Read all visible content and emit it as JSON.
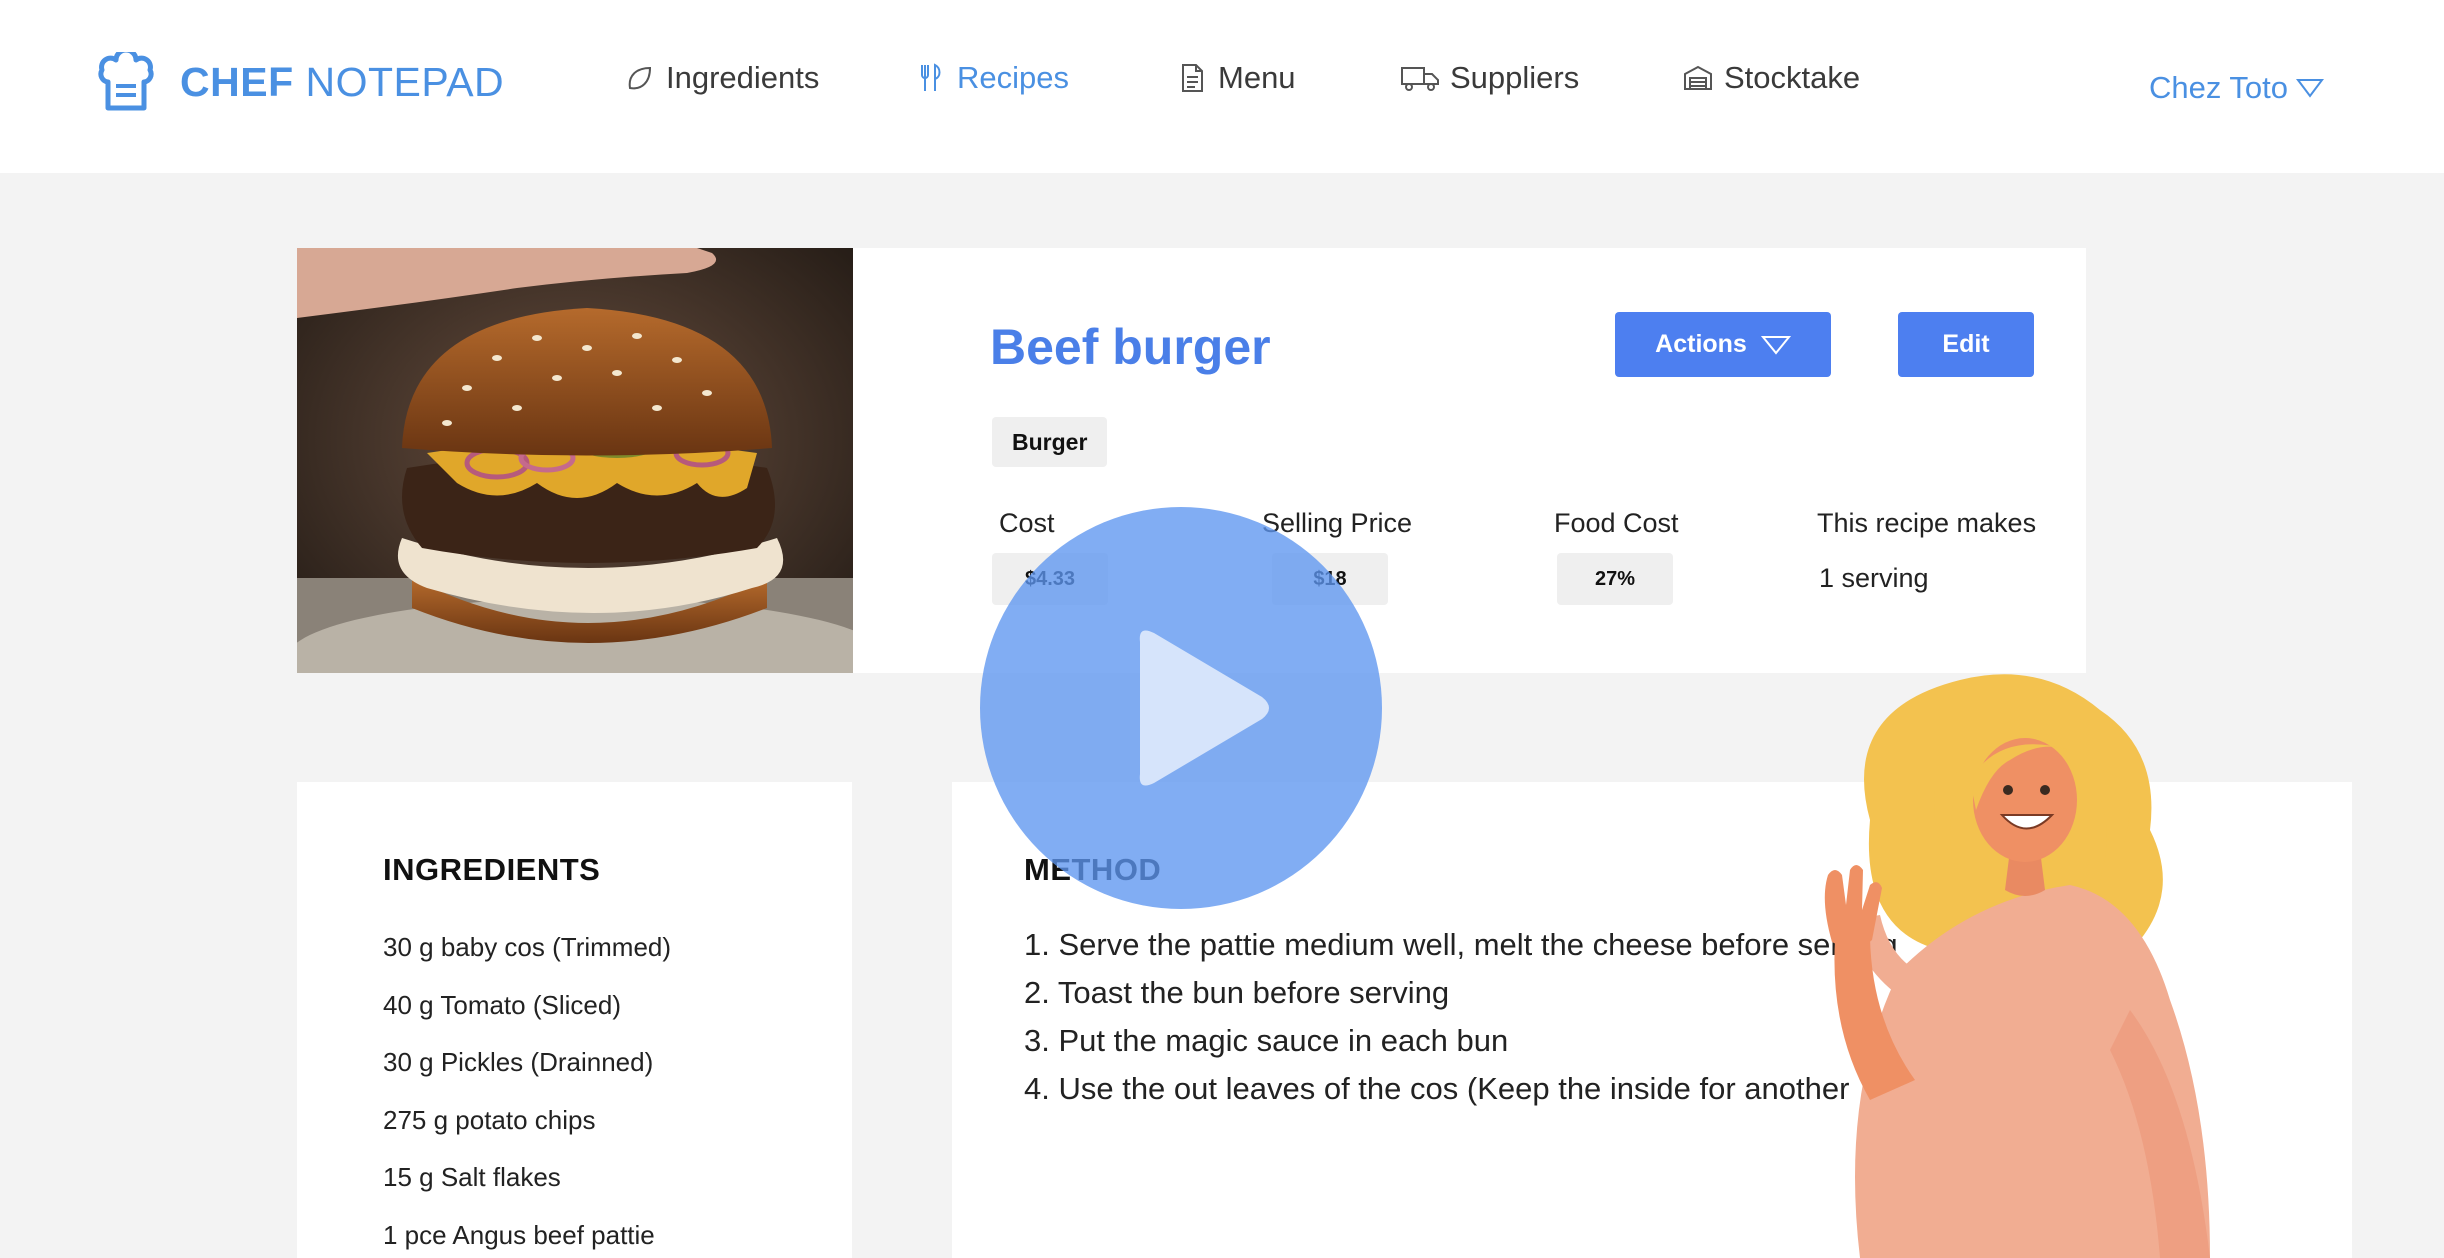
{
  "brand": {
    "name_bold": "CHEF",
    "name_light": "NOTEPAD",
    "color": "#4a90e2"
  },
  "nav": {
    "items": [
      {
        "label": "Ingredients",
        "icon": "leaf-icon",
        "active": false
      },
      {
        "label": "Recipes",
        "icon": "fork-knife-icon",
        "active": true
      },
      {
        "label": "Menu",
        "icon": "document-icon",
        "active": false
      },
      {
        "label": "Suppliers",
        "icon": "truck-icon",
        "active": false
      },
      {
        "label": "Stocktake",
        "icon": "warehouse-icon",
        "active": false
      }
    ],
    "org_name": "Chez Toto"
  },
  "recipe": {
    "title": "Beef burger",
    "actions_label": "Actions",
    "edit_label": "Edit",
    "tag": "Burger",
    "stats": {
      "cost_label": "Cost",
      "cost_value": "$4.33",
      "selling_price_label": "Selling Price",
      "selling_price_value": "$18",
      "food_cost_label": "Food Cost",
      "food_cost_value": "27%",
      "makes_label": "This recipe makes",
      "makes_value": "1 serving"
    }
  },
  "ingredients": {
    "title": "INGREDIENTS",
    "items": [
      "30 g baby cos (Trimmed)",
      "40 g Tomato (Sliced)",
      "30 g Pickles (Drainned)",
      "275 g potato chips",
      "15 g Salt flakes",
      "1 pce Angus beef pattie"
    ]
  },
  "method": {
    "title": "METHOD",
    "steps": [
      "1. Serve the pattie medium well, melt the cheese before serving",
      "2. Toast the bun before serving",
      "3. Put the magic sauce in each bun",
      "4. Use the out leaves of the cos (Keep the inside for another"
    ]
  },
  "colors": {
    "accent": "#4a7fe8",
    "button": "#4d7ff0",
    "page_bg": "#f3f3f3",
    "play_overlay": "#5e96f0"
  }
}
